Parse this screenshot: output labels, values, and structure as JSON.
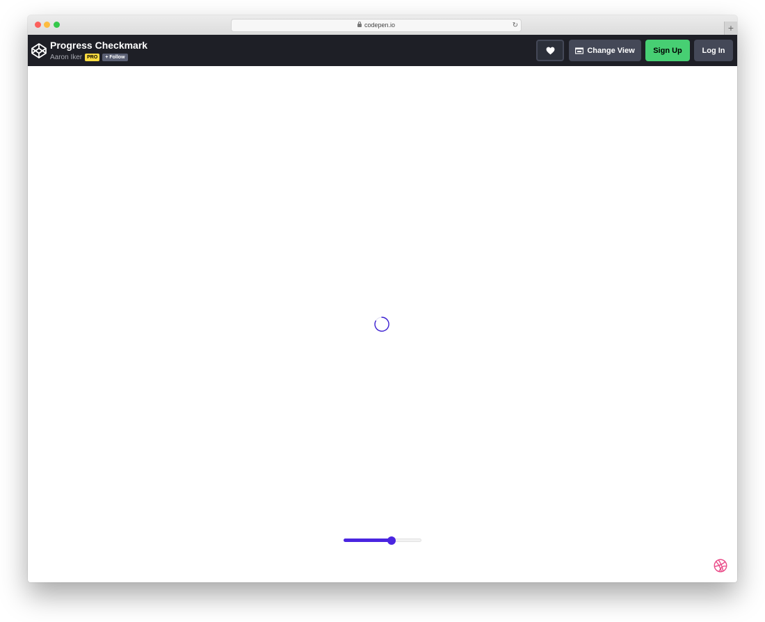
{
  "browser": {
    "url": "codepen.io",
    "new_tab_label": "+",
    "reload_glyph": "↻"
  },
  "header": {
    "pen_title": "Progress Checkmark",
    "author": "Aaron Iker",
    "pro_badge": "PRO",
    "follow_label": "+ Follow",
    "heart_icon": "heart-icon",
    "change_view_label": "Change View",
    "signup_label": "Sign Up",
    "login_label": "Log In"
  },
  "demo": {
    "spinner_arc_color": "#3b1fd1",
    "slider": {
      "value_fraction": 0.62,
      "accent": "#4a25e0"
    },
    "dribbble_icon": "dribbble-icon",
    "dribbble_color": "#ea4c89"
  },
  "colors": {
    "header_bg": "#1e1f26",
    "signup_bg": "#47cf73",
    "button_bg": "#444857",
    "pro_bg": "#ffdd40"
  }
}
